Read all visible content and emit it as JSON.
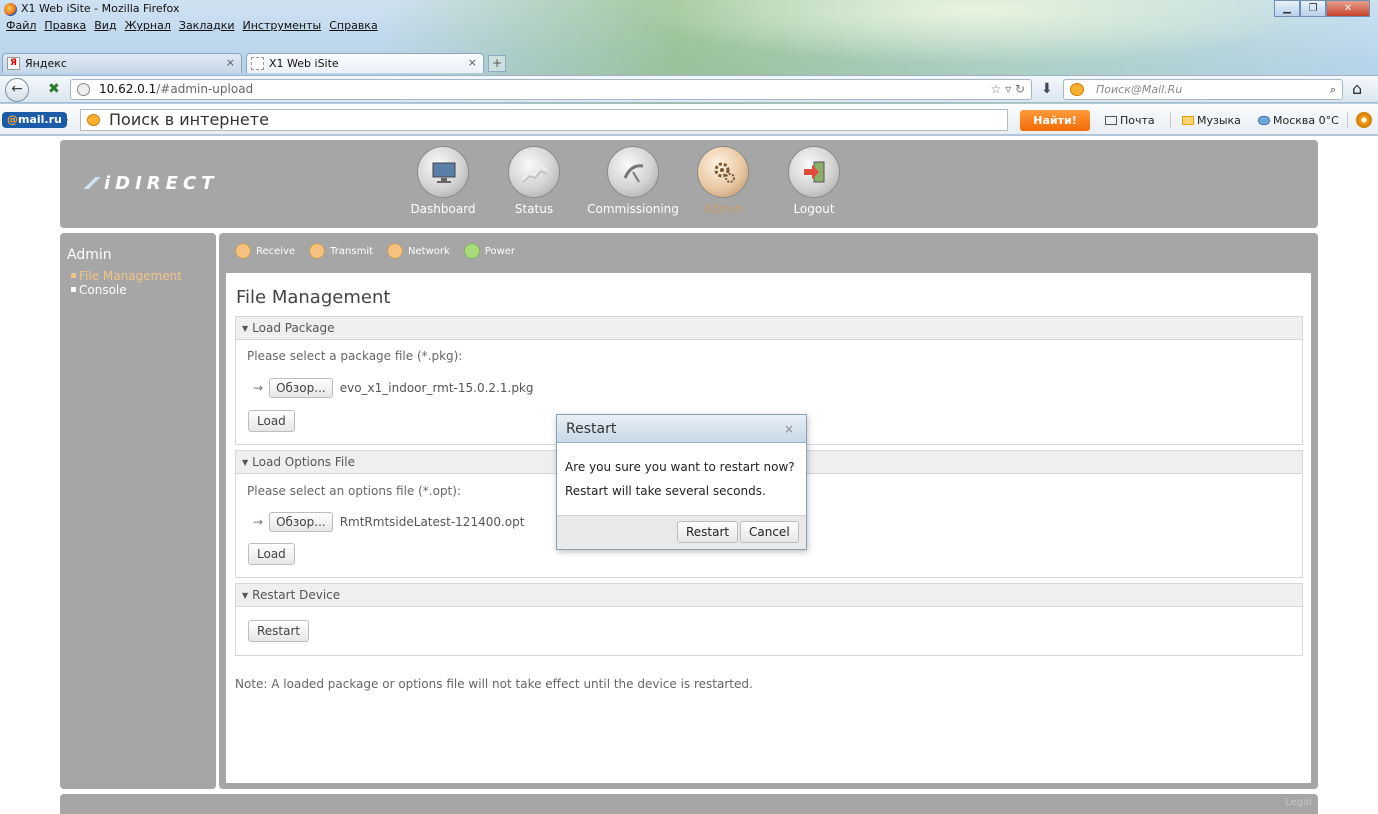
{
  "window": {
    "title": "X1 Web iSite - Mozilla Firefox"
  },
  "menu": [
    "Файл",
    "Правка",
    "Вид",
    "Журнал",
    "Закладки",
    "Инструменты",
    "Справка"
  ],
  "tabs": [
    {
      "label": "Яндекс",
      "active": false
    },
    {
      "label": "X1 Web iSite",
      "active": true
    }
  ],
  "nav": {
    "host": "10.62.0.1",
    "path": "/#admin-upload",
    "search_placeholder": "Поиск@Mail.Ru"
  },
  "mailru": {
    "logo_at": "@",
    "logo_text": "mail.ru",
    "search_placeholder": "Поиск в интернете",
    "find_label": "Найти!",
    "links": [
      "Почта",
      "Музыка",
      "Москва 0°C"
    ]
  },
  "app": {
    "logo": "iDIRECT",
    "main_nav": [
      {
        "label": "Dashboard",
        "icon": "monitor-icon",
        "active": false
      },
      {
        "label": "Status",
        "icon": "chart-icon",
        "active": false
      },
      {
        "label": "Commissioning",
        "icon": "satellite-icon",
        "active": false
      },
      {
        "label": "Admin",
        "icon": "gears-icon",
        "active": true
      },
      {
        "label": "Logout",
        "icon": "exit-door-icon",
        "active": false
      }
    ],
    "sidebar": {
      "title": "Admin",
      "items": [
        {
          "label": "File Management",
          "active": true
        },
        {
          "label": "Console",
          "active": false
        }
      ]
    },
    "subnav": [
      {
        "label": "Receive",
        "color": "#f4c27e"
      },
      {
        "label": "Transmit",
        "color": "#f4c27e"
      },
      {
        "label": "Network",
        "color": "#f4c27e"
      },
      {
        "label": "Power",
        "color": "#a8dc7a"
      }
    ],
    "page_title": "File Management",
    "sections": {
      "package": {
        "title": "Load Package",
        "prompt": "Please select a package file (*.pkg):",
        "browse_label": "Обзор...",
        "file_name": "evo_x1_indoor_rmt-15.0.2.1.pkg",
        "button": "Load"
      },
      "options": {
        "title": "Load Options File",
        "prompt": "Please select an options file (*.opt):",
        "browse_label": "Обзор...",
        "file_name": "RmtRmtsideLatest-121400.opt",
        "button": "Load"
      },
      "restart": {
        "title": "Restart Device",
        "button": "Restart"
      }
    },
    "note": "Note: A loaded package or options file will not take effect until the device is restarted.",
    "footer": "Legal"
  },
  "dialog": {
    "title": "Restart",
    "close": "×",
    "line1": "Are you sure you want to restart now?",
    "line2": "Restart will take several seconds.",
    "confirm": "Restart",
    "cancel": "Cancel"
  }
}
